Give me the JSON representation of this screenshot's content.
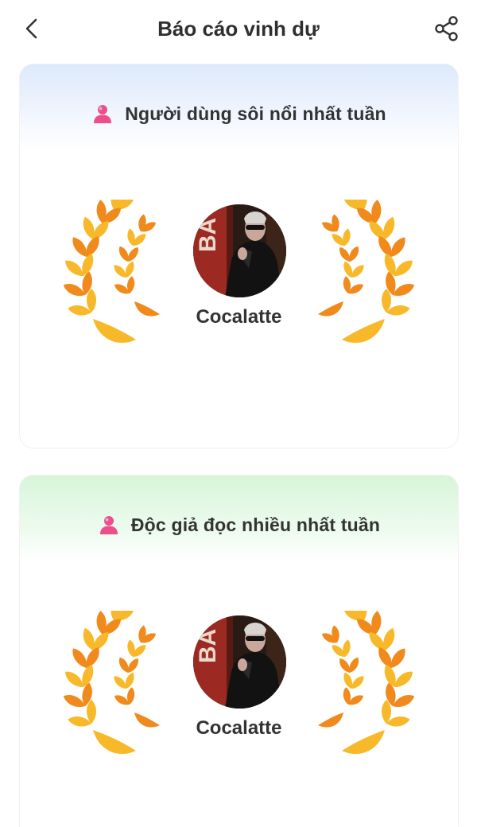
{
  "header": {
    "title": "Báo cáo vinh dự",
    "back_icon": "chevron-left-icon",
    "share_icon": "share-icon"
  },
  "cards": [
    {
      "title": "Người dùng sôi nổi nhất tuần",
      "icon": "user-icon",
      "username": "Cocalatte",
      "header_gradient_color": "#dde9fb"
    },
    {
      "title": "Độc giả đọc nhiều nhất tuần",
      "icon": "user-icon",
      "username": "Cocalatte",
      "header_gradient_color": "#d7f5d9"
    }
  ],
  "colors": {
    "icon_pink": "#ec4f8c",
    "laurel_gold": "#f7b92a",
    "laurel_orange": "#f08a1c"
  }
}
